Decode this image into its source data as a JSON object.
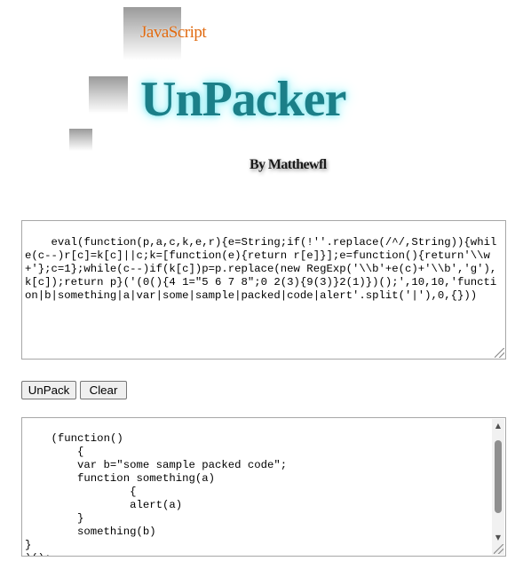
{
  "header": {
    "logo_small": "JavaScript",
    "logo_title": "UnPacker",
    "byline": "By Matthewfl"
  },
  "input": {
    "value": "eval(function(p,a,c,k,e,r){e=String;if(!''.replace(/^/,String)){while(c--)r[c]=k[c]||c;k=[function(e){return r[e]}];e=function(){return'\\\\w+'};c=1};while(c--)if(k[c])p=p.replace(new RegExp('\\\\b'+e(c)+'\\\\b','g'),k[c]);return p}('(0(){4 1=\"5 6 7 8\";0 2(3){9(3)}2(1)})();',10,10,'function|b|something|a|var|some|sample|packed|code|alert'.split('|'),0,{}))"
  },
  "buttons": {
    "unpack": "UnPack",
    "clear": "Clear"
  },
  "output": {
    "value": "(function()\n        {\n        var b=\"some sample packed code\";\n        function something(a)\n                {\n                alert(a)\n        }\n        something(b)\n}\n)();"
  },
  "icons": {
    "scroll_up": "triangle-up-icon",
    "scroll_down": "triangle-down-icon",
    "resize": "resize-grip-icon"
  }
}
